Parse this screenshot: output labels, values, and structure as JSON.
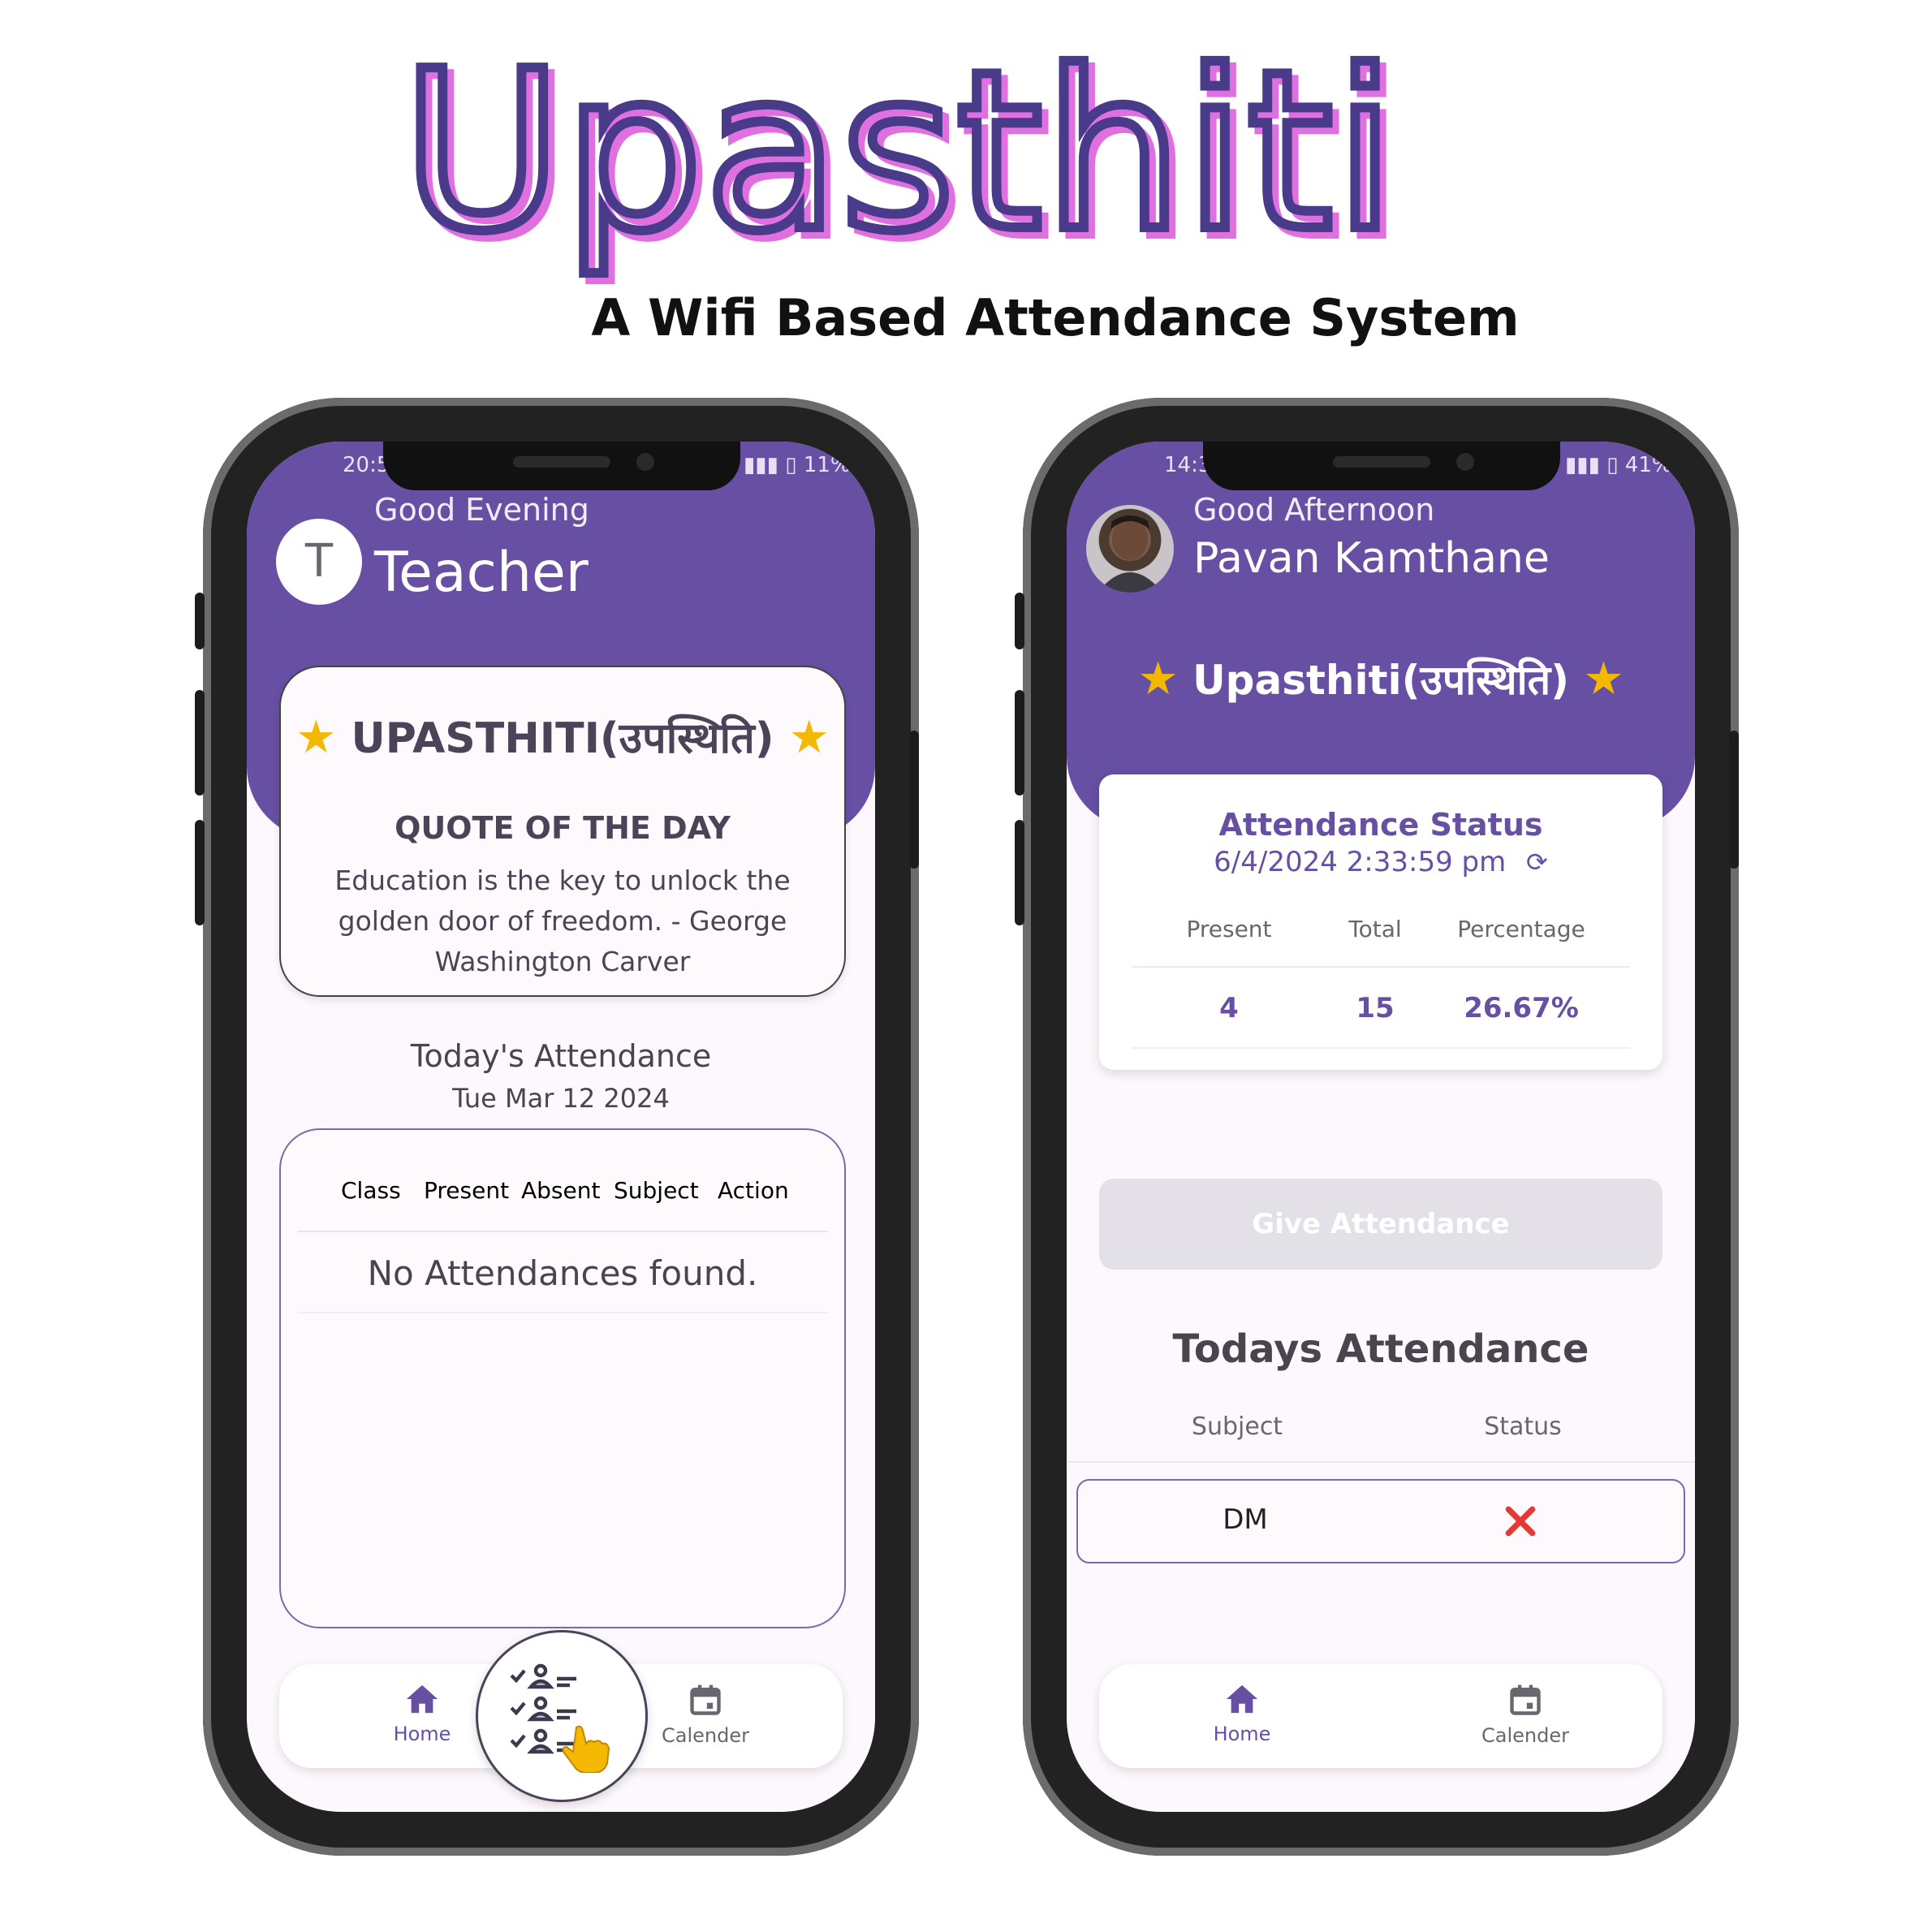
{
  "brand": {
    "title": "Upasthiti",
    "subtitle": "A Wifi Based Attendance System",
    "colors": {
      "purple": "#6750a4",
      "pink": "#e070e0",
      "dark": "#4a3a8a"
    }
  },
  "teacher_phone": {
    "status_time": "20:5",
    "battery": "11%",
    "greeting": "Good Evening",
    "avatar_letter": "T",
    "user_name": "Teacher",
    "card_title": "UPASTHITI(उपस्थिति)",
    "quote_heading": "QUOTE OF THE DAY",
    "quote_text": "Education is the key to unlock the golden door of freedom. - George Washington Carver",
    "today_title": "Today's Attendance",
    "today_date": "Tue Mar 12 2024",
    "table_headers": [
      "Class",
      "Present",
      "Absent",
      "Subject",
      "Action"
    ],
    "empty_message": "No Attendances found.",
    "nav": {
      "home": "Home",
      "calender": "Calender"
    }
  },
  "student_phone": {
    "status_time": "14:3",
    "battery": "41%",
    "greeting": "Good Afternoon",
    "user_name": "Pavan Kamthane",
    "banner": "Upasthiti(उपस्थिति)",
    "status_title": "Attendance Status",
    "status_datetime": "6/4/2024 2:33:59 pm",
    "stats_headers": [
      "Present",
      "Total",
      "Percentage"
    ],
    "stats_values": [
      "4",
      "15",
      "26.67%"
    ],
    "give_button": "Give Attendance",
    "todays_title": "Todays Attendance",
    "table_headers": [
      "Subject",
      "Status"
    ],
    "rows": [
      {
        "subject": "DM",
        "status_icon": "cross-icon"
      }
    ],
    "nav": {
      "home": "Home",
      "calender": "Calender"
    }
  }
}
